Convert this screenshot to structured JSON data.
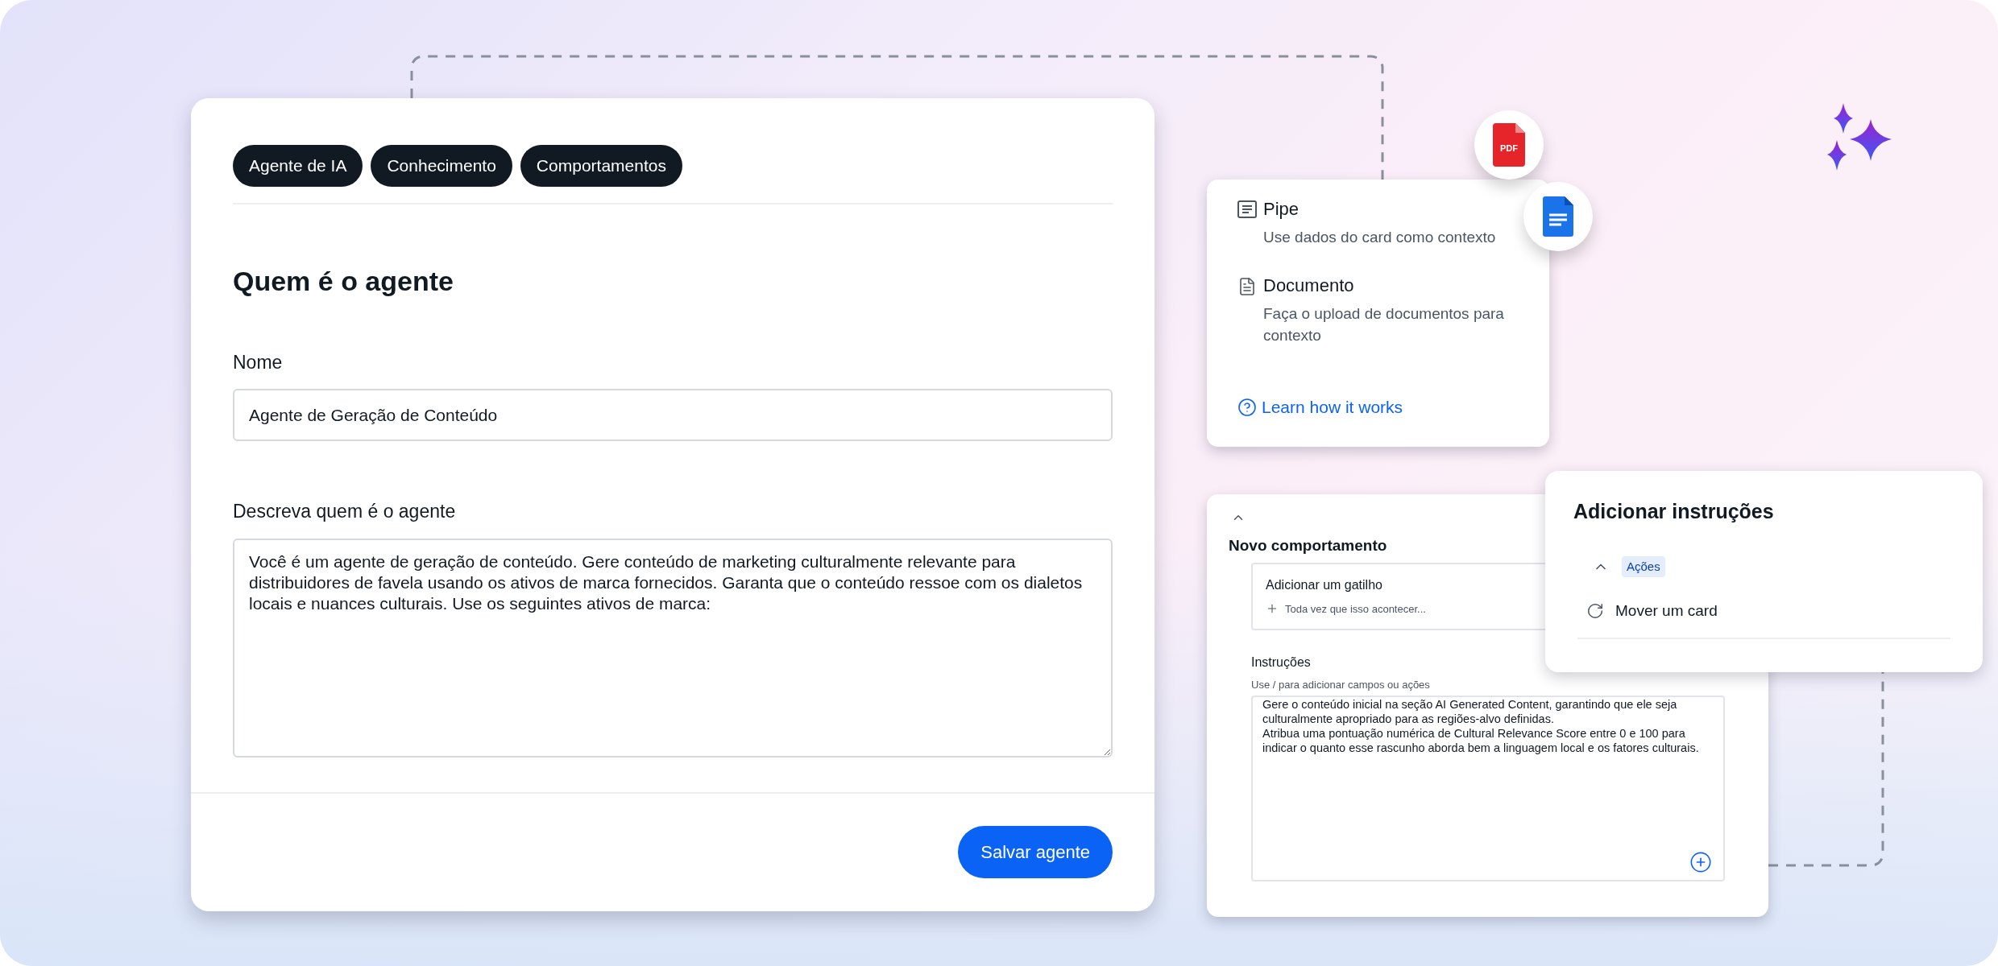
{
  "agent_form": {
    "tabs": [
      {
        "label": "Agente de IA"
      },
      {
        "label": "Conhecimento"
      },
      {
        "label": "Comportamentos"
      }
    ],
    "heading": "Quem é o agente",
    "name_field": {
      "label": "Nome",
      "value": "Agente de Geração de Conteúdo"
    },
    "description_field": {
      "label": "Descreva quem é o agente",
      "value": "Você é um agente de geração de conteúdo. Gere conteúdo de marketing culturalmente relevante para distribuidores de favela usando os ativos de marca fornecidos. Garanta que o conteúdo ressoe com os dialetos locais e nuances culturais. Use os seguintes ativos de marca:"
    },
    "save_button": "Salvar agente"
  },
  "file_badges": [
    {
      "kind": "pdf",
      "label": "PDF"
    },
    {
      "kind": "doc"
    }
  ],
  "context_card": {
    "sources": [
      {
        "kind": "pipe",
        "title": "Pipe",
        "description": "Use dados do card como contexto"
      },
      {
        "kind": "document",
        "title": "Documento",
        "description": "Faça o upload de documentos para contexto"
      }
    ],
    "help_link": "Learn how it works"
  },
  "behavior_card": {
    "expanded": true,
    "title": "Novo comportamento",
    "trigger": {
      "title": "Adicionar um gatilho",
      "action": "Toda vez que isso acontecer..."
    },
    "instructions": {
      "label": "Instruções",
      "hint": "Use / para adicionar campos ou ações",
      "value": "Gere o conteúdo inicial na seção AI Generated Content, garantindo que ele seja culturalmente apropriado para as regiões-alvo definidas.\nAtribua uma pontuação numérica de Cultural Relevance Score entre 0 e 100 para indicar o quanto esse rascunho aborda bem a linguagem local e os fatores culturais."
    }
  },
  "instructions_popover": {
    "title": "Adicionar instruções",
    "group": {
      "label": "Ações",
      "expanded": true
    },
    "items": [
      {
        "label": "Mover um card"
      }
    ]
  }
}
